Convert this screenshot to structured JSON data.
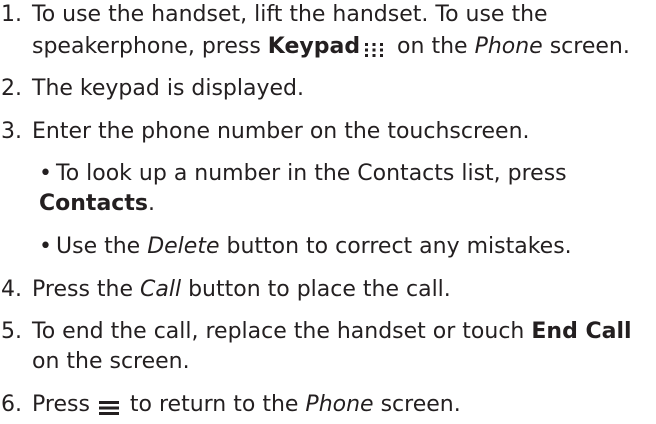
{
  "steps": [
    {
      "number": "1.",
      "line1_a": "To use the handset, lift the handset. To use the",
      "line2_a": "speakerphone, press ",
      "line2_bold": "Keypad",
      "line2_b": " on the ",
      "line2_italic": "Phone",
      "line2_c": " screen."
    },
    {
      "number": "2.",
      "text": "The keypad is displayed."
    },
    {
      "number": "3.",
      "text": "Enter the phone number on the touchscreen.",
      "bullets": [
        {
          "bullet": "•",
          "line1": "To look up a number in the Contacts list, press",
          "line2_bold": "Contacts",
          "line2_end": "."
        },
        {
          "bullet": "•",
          "text_a": "Use the ",
          "text_italic": "Delete",
          "text_b": " button to correct any mistakes."
        }
      ]
    },
    {
      "number": "4.",
      "text_a": "Press the ",
      "text_italic": "Call",
      "text_b": " button to place the call."
    },
    {
      "number": "5.",
      "line1_a": "To end the call, replace the handset or touch ",
      "line1_bold": "End Call",
      "line2": "on the screen."
    },
    {
      "number": "6.",
      "text_a": "Press ",
      "text_b": " to return to the ",
      "text_italic": "Phone",
      "text_c": " screen."
    }
  ],
  "icons": {
    "keypad": "keypad-icon",
    "menu": "menu-icon"
  }
}
